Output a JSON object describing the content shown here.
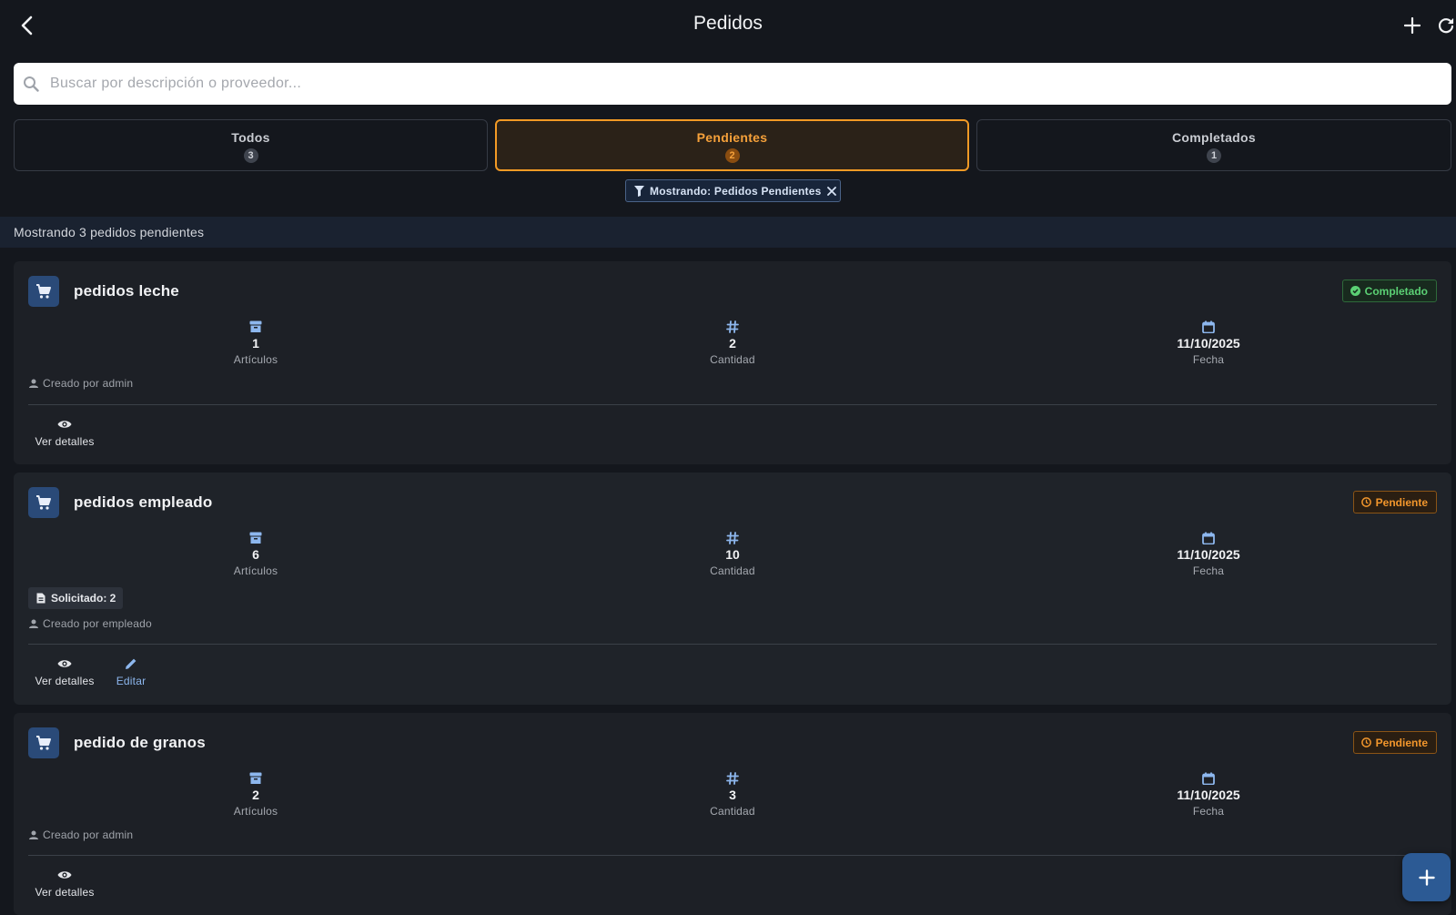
{
  "app": {
    "title": "Pedidos"
  },
  "search": {
    "placeholder": "Buscar por descripción o proveedor...",
    "value": ""
  },
  "tabs": [
    {
      "label": "Todos",
      "count": "3",
      "active": false
    },
    {
      "label": "Pendientes",
      "count": "2",
      "active": true
    },
    {
      "label": "Completados",
      "count": "1",
      "active": false
    }
  ],
  "filter_chip": {
    "label": "Mostrando: Pedidos Pendientes"
  },
  "info_bar": {
    "text": "Mostrando 3 pedidos pendientes"
  },
  "orders": [
    {
      "title": "pedidos leche",
      "status": "Completado",
      "articles_value": "1",
      "articles_label": "Artículos",
      "quantity_value": "2",
      "quantity_label": "Cantidad",
      "date_value": "11/10/2025",
      "date_label": "Fecha",
      "creator": "Creado por admin",
      "actions": {
        "view": "Ver detalles"
      }
    },
    {
      "title": "pedidos empleado",
      "status": "Pendiente",
      "articles_value": "6",
      "articles_label": "Artículos",
      "quantity_value": "10",
      "quantity_label": "Cantidad",
      "date_value": "11/10/2025",
      "date_label": "Fecha",
      "requested": "Solicitado: 2",
      "creator": "Creado por empleado",
      "actions": {
        "view": "Ver detalles",
        "edit": "Editar"
      }
    },
    {
      "title": "pedido de granos",
      "status": "Pendiente",
      "articles_value": "2",
      "articles_label": "Artículos",
      "quantity_value": "3",
      "quantity_label": "Cantidad",
      "date_value": "11/10/2025",
      "date_label": "Fecha",
      "creator": "Creado por admin",
      "actions": {
        "view": "Ver detalles"
      }
    }
  ],
  "icons": {
    "back": "chevron-left-icon",
    "add": "plus-icon",
    "refresh": "refresh-icon",
    "search": "search-icon",
    "filter": "filter-icon",
    "close": "close-icon",
    "cart": "cart-icon",
    "archive": "archive-icon",
    "hash": "hash-icon",
    "calendar": "calendar-icon",
    "person": "person-icon",
    "eye": "eye-icon",
    "pencil": "pencil-icon",
    "document": "document-icon",
    "check_circle": "check-circle-icon",
    "clock": "clock-icon"
  },
  "colors": {
    "background": "#14171d",
    "card": "#1d2026",
    "accent_orange": "#f29a25",
    "accent_blue": "#2c5a94",
    "icon_blue": "#8db7ee",
    "success_green": "#5bd074",
    "info_bar": "#1a2230"
  }
}
